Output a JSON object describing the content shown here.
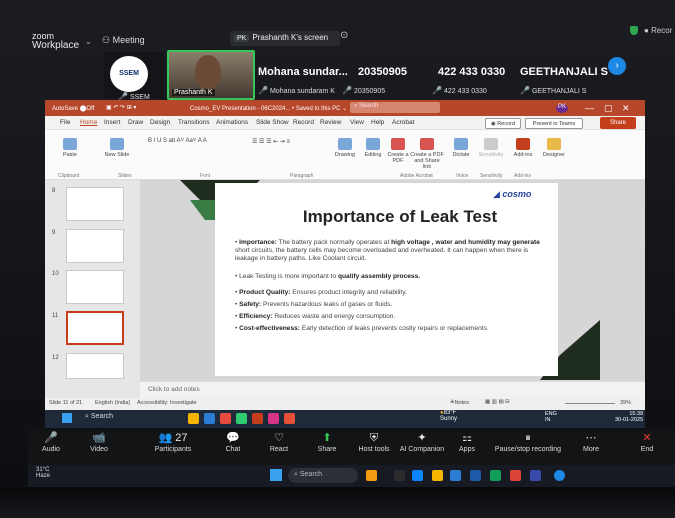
{
  "zoom": {
    "brand_line1": "zoom",
    "brand_line2": "Workplace",
    "meeting_label": "Meeting",
    "screen_label": "Prashanth K's screen",
    "screen_badge": "PK",
    "record_label": "Recor",
    "participants": [
      {
        "name": "Mohana sundar...",
        "sub": "Mohana sundaram K"
      },
      {
        "name": "20350905",
        "sub": "20350905"
      },
      {
        "name": "422 433 0330",
        "sub": "422 433 0330"
      },
      {
        "name": "GEETHANJALI S",
        "sub": "GEETHANJALI S"
      }
    ],
    "ssem_label": "SSEM",
    "ssem_sub": "SSEM",
    "cam_name": "Prashanth K"
  },
  "ppt": {
    "autosave": "AutoSave",
    "off": "Off",
    "filename": "Cosmo_EV Presentation - 06C2024... • Saved to this PC ⌄",
    "search": "Search",
    "user": "PK",
    "menu": [
      "File",
      "Home",
      "Insert",
      "Draw",
      "Design",
      "Transitions",
      "Animations",
      "Slide Show",
      "Record",
      "Review",
      "View",
      "Help",
      "Acrobat"
    ],
    "record_btn": "Record",
    "present_btn": "Present in Teams",
    "share_btn": "Share",
    "ribbon": [
      "Paste",
      "New Slide",
      "Drawing",
      "Editing",
      "Create a PDF",
      "Create a PDF and Share link",
      "Dictate",
      "Sensitivity",
      "Add-ins",
      "Designer"
    ],
    "ribbon_groups": [
      "Clipboard",
      "Slides",
      "Font",
      "Paragraph",
      "Adobe Acrobat",
      "Voice",
      "Sensitivity",
      "Add-ins"
    ],
    "slide_numbers": [
      "8",
      "9",
      "10",
      "11",
      "12"
    ],
    "notes": "Click to add notes",
    "status": {
      "slide": "Slide 11 of 21",
      "lang": "English (India)",
      "access": "Accessibility: Investigate",
      "notes": "Notes",
      "zoom": "39%"
    }
  },
  "slide": {
    "logo": "cosmo",
    "title": "Importance of Leak Test",
    "b1_lead": "Importance:",
    "b1_text": " The battery pack normally operates at ",
    "b1_bold": "high voltage , water and humidity may generate",
    "b1_rest": " short circuits, the battery cells may become overloaded and overheated. It can happen when there is leakage in battery paths. Like Coolant circuit.",
    "b2_text": "Leak Testing is more important to ",
    "b2_bold": "qualify assembly process.",
    "b3_lead": "Product Quality:",
    "b3_text": " Ensures product integrity and reliability.",
    "b4_lead": "Safety:",
    "b4_text": " Prevents hazardous leaks of gases or fluids.",
    "b5_lead": "Efficiency:",
    "b5_text": " Reduces waste and energy consumption.",
    "b6_lead": "Cost-effectiveness:",
    "b6_text": " Early detection of leaks prevents costly repairs or replacements."
  },
  "taskbar_inner": {
    "search": "Search",
    "weather_temp": "83°F",
    "weather": "Sunny",
    "lang": "ENG",
    "lang2": "IN",
    "time": "15:38",
    "date": "30-01-2025"
  },
  "controls": [
    {
      "icon": "🎤",
      "label": "Audio"
    },
    {
      "icon": "📹",
      "label": "Video"
    },
    {
      "icon": "👥",
      "label": "Participants"
    },
    {
      "icon": "💬",
      "label": "Chat"
    },
    {
      "icon": "♡",
      "label": "React"
    },
    {
      "icon": "⬆",
      "label": "Share"
    },
    {
      "icon": "⛨",
      "label": "Host tools"
    },
    {
      "icon": "✦",
      "label": "AI Companion"
    },
    {
      "icon": "⚏",
      "label": "Apps"
    },
    {
      "icon": "⏸",
      "label": "Pause/stop recording"
    },
    {
      "icon": "⋯",
      "label": "More"
    },
    {
      "icon": "✕",
      "label": "End"
    }
  ],
  "participants_count": "27",
  "taskbar_outer": {
    "temp": "31°C",
    "weather": "Haze",
    "search": "Search"
  }
}
